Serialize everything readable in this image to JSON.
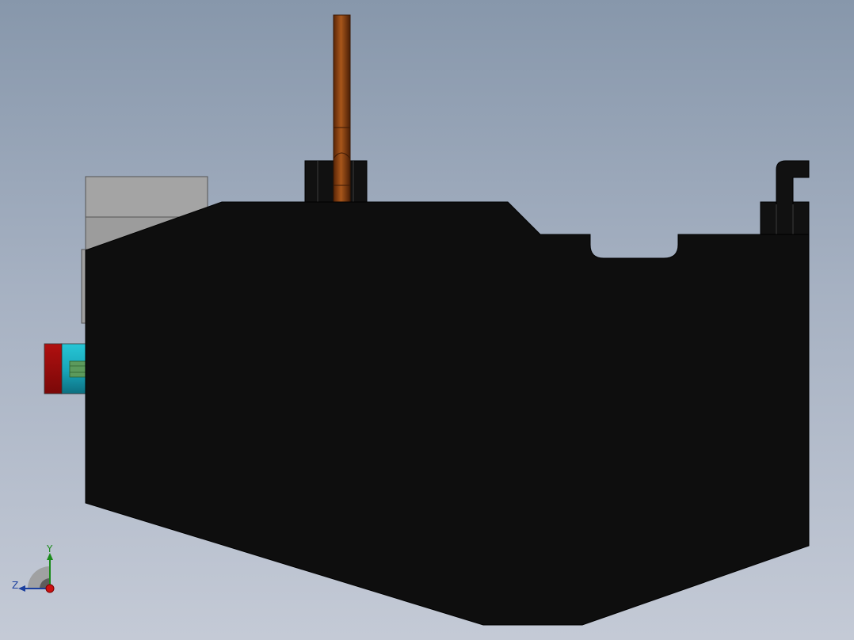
{
  "viewport": {
    "background_top": "#8797ab",
    "background_bottom": "#c4cad6"
  },
  "model": {
    "parts": [
      {
        "name": "main-body",
        "color": "#0e0e0e"
      },
      {
        "name": "vertical-rod",
        "color": "#8a3d0b"
      },
      {
        "name": "top-block",
        "color": "#111111"
      },
      {
        "name": "gray-bracket",
        "color": "#a7a7a7"
      },
      {
        "name": "cylinder-cap",
        "color": "#9e0b0b"
      },
      {
        "name": "cylinder-body",
        "color": "#1bb3c4"
      },
      {
        "name": "cylinder-inner",
        "color": "#5aa05a"
      },
      {
        "name": "hook-bracket",
        "color": "#111111"
      }
    ]
  },
  "triad": {
    "y_label": "Y",
    "z_label": "Z",
    "y_color": "#1a8a1a",
    "z_color": "#1b3f9e",
    "x_color": "#cc1111"
  }
}
